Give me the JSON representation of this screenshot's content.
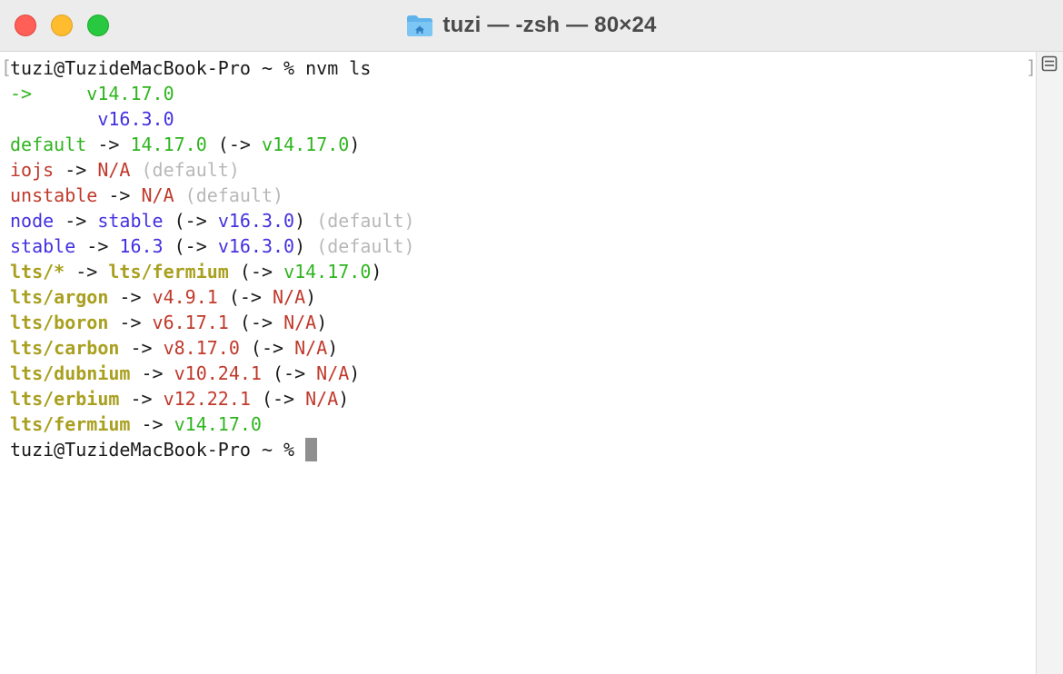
{
  "window": {
    "title": "tuzi — -zsh — 80×24",
    "icon": "home-folder-icon"
  },
  "colors": {
    "green": "#2fb51f",
    "blue": "#4331e0",
    "red": "#c0392b",
    "gray": "#b8b8b8",
    "yellow": "#a9a020",
    "foreground": "#1a1a1a"
  },
  "terminal": {
    "lines": [
      [
        {
          "t": "tuzi@TuzideMacBook-Pro ~ % nvm ls",
          "c": "fg"
        }
      ],
      [
        {
          "t": "->     v14.17.0",
          "c": "green"
        }
      ],
      [
        {
          "t": "        ",
          "c": "fg"
        },
        {
          "t": "v16.3.0",
          "c": "blue"
        }
      ],
      [
        {
          "t": "default",
          "c": "green"
        },
        {
          "t": " -> ",
          "c": "fg"
        },
        {
          "t": "14.17.0",
          "c": "green"
        },
        {
          "t": " (-> ",
          "c": "fg"
        },
        {
          "t": "v14.17.0",
          "c": "green"
        },
        {
          "t": ")",
          "c": "fg"
        }
      ],
      [
        {
          "t": "iojs",
          "c": "red"
        },
        {
          "t": " -> ",
          "c": "fg"
        },
        {
          "t": "N/A",
          "c": "red"
        },
        {
          "t": " (default)",
          "c": "gray"
        }
      ],
      [
        {
          "t": "unstable",
          "c": "red"
        },
        {
          "t": " -> ",
          "c": "fg"
        },
        {
          "t": "N/A",
          "c": "red"
        },
        {
          "t": " (default)",
          "c": "gray"
        }
      ],
      [
        {
          "t": "node",
          "c": "blue"
        },
        {
          "t": " -> ",
          "c": "fg"
        },
        {
          "t": "stable",
          "c": "blue"
        },
        {
          "t": " (-> ",
          "c": "fg"
        },
        {
          "t": "v16.3.0",
          "c": "blue"
        },
        {
          "t": ")",
          "c": "fg"
        },
        {
          "t": " (default)",
          "c": "gray"
        }
      ],
      [
        {
          "t": "stable",
          "c": "blue"
        },
        {
          "t": " -> ",
          "c": "fg"
        },
        {
          "t": "16.3",
          "c": "blue"
        },
        {
          "t": " (-> ",
          "c": "fg"
        },
        {
          "t": "v16.3.0",
          "c": "blue"
        },
        {
          "t": ")",
          "c": "fg"
        },
        {
          "t": " (default)",
          "c": "gray"
        }
      ],
      [
        {
          "t": "lts/*",
          "c": "yellow"
        },
        {
          "t": " -> ",
          "c": "fg"
        },
        {
          "t": "lts/fermium",
          "c": "yellow"
        },
        {
          "t": " (-> ",
          "c": "fg"
        },
        {
          "t": "v14.17.0",
          "c": "green"
        },
        {
          "t": ")",
          "c": "fg"
        }
      ],
      [
        {
          "t": "lts/argon",
          "c": "yellow"
        },
        {
          "t": " -> ",
          "c": "fg"
        },
        {
          "t": "v4.9.1",
          "c": "red"
        },
        {
          "t": " (-> ",
          "c": "fg"
        },
        {
          "t": "N/A",
          "c": "red"
        },
        {
          "t": ")",
          "c": "fg"
        }
      ],
      [
        {
          "t": "lts/boron",
          "c": "yellow"
        },
        {
          "t": " -> ",
          "c": "fg"
        },
        {
          "t": "v6.17.1",
          "c": "red"
        },
        {
          "t": " (-> ",
          "c": "fg"
        },
        {
          "t": "N/A",
          "c": "red"
        },
        {
          "t": ")",
          "c": "fg"
        }
      ],
      [
        {
          "t": "lts/carbon",
          "c": "yellow"
        },
        {
          "t": " -> ",
          "c": "fg"
        },
        {
          "t": "v8.17.0",
          "c": "red"
        },
        {
          "t": " (-> ",
          "c": "fg"
        },
        {
          "t": "N/A",
          "c": "red"
        },
        {
          "t": ")",
          "c": "fg"
        }
      ],
      [
        {
          "t": "lts/dubnium",
          "c": "yellow"
        },
        {
          "t": " -> ",
          "c": "fg"
        },
        {
          "t": "v10.24.1",
          "c": "red"
        },
        {
          "t": " (-> ",
          "c": "fg"
        },
        {
          "t": "N/A",
          "c": "red"
        },
        {
          "t": ")",
          "c": "fg"
        }
      ],
      [
        {
          "t": "lts/erbium",
          "c": "yellow"
        },
        {
          "t": " -> ",
          "c": "fg"
        },
        {
          "t": "v12.22.1",
          "c": "red"
        },
        {
          "t": " (-> ",
          "c": "fg"
        },
        {
          "t": "N/A",
          "c": "red"
        },
        {
          "t": ")",
          "c": "fg"
        }
      ],
      [
        {
          "t": "lts/fermium",
          "c": "yellow"
        },
        {
          "t": " -> ",
          "c": "fg"
        },
        {
          "t": "v14.17.0",
          "c": "green"
        }
      ],
      [
        {
          "t": "tuzi@TuzideMacBook-Pro ~ % ",
          "c": "fg"
        }
      ]
    ]
  }
}
